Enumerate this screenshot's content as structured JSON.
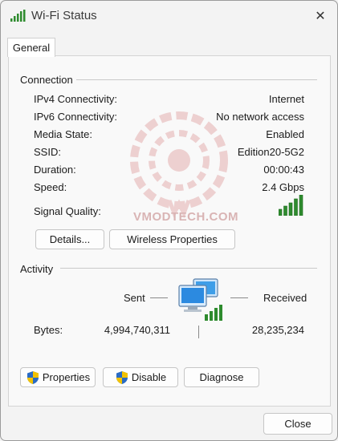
{
  "window": {
    "title": "Wi-Fi Status",
    "close_glyph": "✕"
  },
  "tabs": [
    {
      "label": "General"
    }
  ],
  "connection": {
    "heading": "Connection",
    "rows": [
      {
        "label": "IPv4 Connectivity:",
        "value": "Internet"
      },
      {
        "label": "IPv6 Connectivity:",
        "value": "No network access"
      },
      {
        "label": "Media State:",
        "value": "Enabled"
      },
      {
        "label": "SSID:",
        "value": "Edition20-5G2"
      },
      {
        "label": "Duration:",
        "value": "00:00:43"
      },
      {
        "label": "Speed:",
        "value": "2.4 Gbps"
      }
    ],
    "signal_label": "Signal Quality:",
    "signal_bars": 5,
    "details_button": "Details...",
    "wireless_button": "Wireless Properties"
  },
  "watermark": {
    "text": "VMODTECH.COM"
  },
  "activity": {
    "heading": "Activity",
    "sent_label": "Sent",
    "received_label": "Received",
    "bytes_label": "Bytes:",
    "bytes_sent": "4,994,740,311",
    "bytes_received": "28,235,234",
    "properties_button": "Properties",
    "disable_button": "Disable",
    "diagnose_button": "Diagnose"
  },
  "footer": {
    "close_button": "Close"
  },
  "colors": {
    "signal_green": "#2e8b2e",
    "shield_blue": "#2b6cc4",
    "shield_yellow": "#f2c200"
  }
}
